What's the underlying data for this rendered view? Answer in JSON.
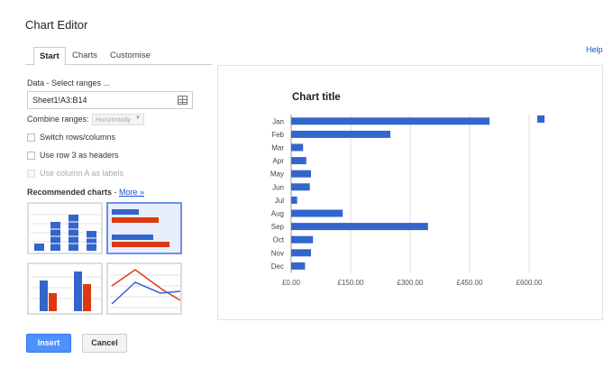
{
  "dialog": {
    "title": "Chart Editor",
    "help": "Help"
  },
  "tabs": [
    "Start",
    "Charts",
    "Customise"
  ],
  "data_section": {
    "label": "Data - Select ranges ...",
    "range_value": "Sheet1!A3:B14",
    "combine_label": "Combine ranges:",
    "combine_value": "Horizontally"
  },
  "options": [
    {
      "label": "Switch rows/columns",
      "checked": false,
      "disabled": false
    },
    {
      "label": "Use row 3 as headers",
      "checked": false,
      "disabled": false
    },
    {
      "label": "Use column A as labels",
      "checked": false,
      "disabled": true
    }
  ],
  "recommended": {
    "label": "Recommended charts",
    "separator": " - ",
    "more": "More »"
  },
  "colors": {
    "blue": "#3366cc",
    "red": "#dc3912",
    "accent": "#4d90fe",
    "link": "#1155cc"
  },
  "chart_data": {
    "type": "bar",
    "orientation": "horizontal",
    "title": "Chart title",
    "categories": [
      "Jan",
      "Feb",
      "Mar",
      "Apr",
      "May",
      "Jun",
      "Jul",
      "Aug",
      "Sep",
      "Oct",
      "Nov",
      "Dec"
    ],
    "values": [
      500,
      250,
      30,
      38,
      50,
      47,
      15,
      130,
      345,
      55,
      50,
      35
    ],
    "xlim": [
      0,
      600
    ],
    "x_ticks": [
      "£0.00",
      "£150.00",
      "£300.00",
      "£450.00",
      "£600.00"
    ],
    "x_tick_values": [
      0,
      150,
      300,
      450,
      600
    ],
    "grid": true,
    "legend": "right",
    "series_color": "#3366cc"
  },
  "buttons": {
    "insert": "Insert",
    "cancel": "Cancel"
  }
}
